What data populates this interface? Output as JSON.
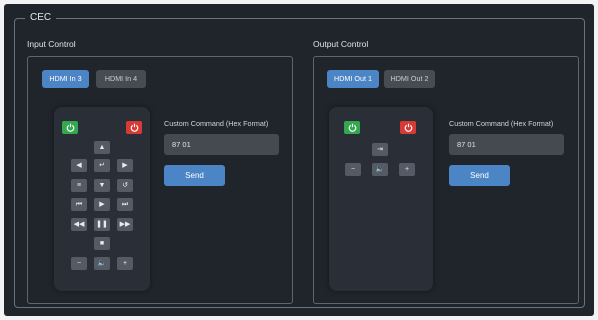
{
  "cec": {
    "legend": "CEC"
  },
  "input_control": {
    "title": "Input Control",
    "tabs": [
      {
        "label": "HDMI In 3",
        "active": true
      },
      {
        "label": "HDMI In 4",
        "active": false
      }
    ],
    "custom_command": {
      "label": "Custom Command (Hex Format)",
      "value": "87 01"
    },
    "send_label": "Send",
    "remote_buttons": [
      "power-on-icon",
      "power-off-icon",
      "arrow-up-icon",
      "arrow-left-icon",
      "enter-icon",
      "arrow-right-icon",
      "menu-icon",
      "arrow-down-icon",
      "back-icon",
      "skip-previous-icon",
      "play-icon",
      "skip-next-icon",
      "rewind-icon",
      "pause-icon",
      "fast-forward-icon",
      "stop-icon",
      "minus-icon",
      "speaker-icon",
      "plus-icon"
    ]
  },
  "output_control": {
    "title": "Output Control",
    "tabs": [
      {
        "label": "HDMI Out 1",
        "active": true
      },
      {
        "label": "HDMI Out 2",
        "active": false
      }
    ],
    "custom_command": {
      "label": "Custom Command (Hex Format)",
      "value": "87 01"
    },
    "send_label": "Send",
    "remote_buttons": [
      "power-on-icon",
      "power-off-icon",
      "input-source-icon",
      "minus-icon",
      "speaker-icon",
      "plus-icon"
    ]
  },
  "colors": {
    "accent": "#4b85c6",
    "power_on": "#34a84f",
    "power_off": "#d63a35",
    "background": "#20242b"
  }
}
